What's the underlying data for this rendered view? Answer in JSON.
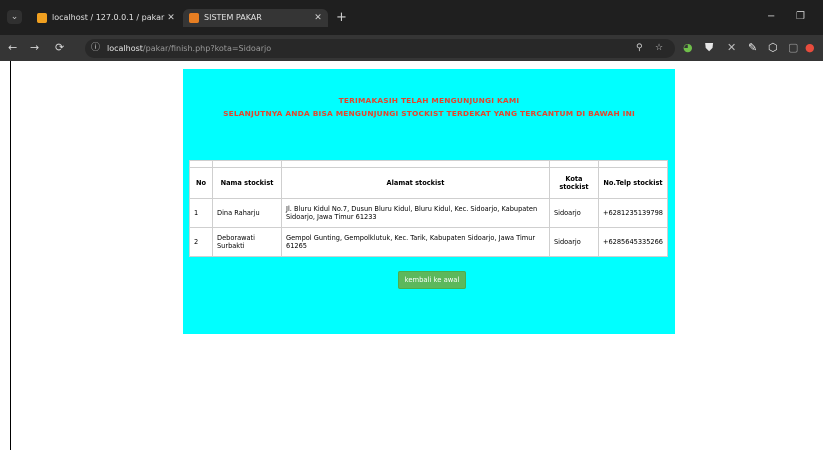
{
  "browser": {
    "tabs": [
      {
        "title": "localhost / 127.0.0.1 / pakar | ph",
        "close": "✕",
        "active": false
      },
      {
        "title": "SISTEM PAKAR",
        "close": "✕",
        "active": true
      }
    ],
    "new_tab": "+",
    "window": {
      "minimize": "−",
      "restore": "❐"
    },
    "nav": {
      "back": "←",
      "forward": "→",
      "reload": "⟳",
      "tab_menu": "⌄"
    },
    "url": {
      "host": "localhost",
      "path": "/pakar/finish.php?kota=Sidoarjo",
      "info_icon": "ⓘ"
    },
    "omnibox_icons": {
      "zoom": "⚲",
      "bookmark": "☆"
    },
    "extensions": [
      "◕",
      "⛊",
      "✕",
      "✎",
      "⬡",
      "▢",
      "●"
    ]
  },
  "page": {
    "heading_line1": "TERIMAKASIH TELAH MENGUNJUNGI KAMI",
    "heading_line2": "SELANJUTNYA ANDA BISA MENGUNJUNGI STOCKIST TERDEKAT YANG TERCANTUM DI BAWAH INI",
    "table": {
      "headers": [
        "No",
        "Nama stockist",
        "Alamat stockist",
        "Kota stockist",
        "No.Telp stockist"
      ],
      "rows": [
        [
          "1",
          "Dina Raharju",
          "Jl. Bluru Kidul No.7, Dusun Bluru Kidul, Bluru Kidul, Kec. Sidoarjo, Kabupaten Sidoarjo, Jawa Timur 61233",
          "Sidoarjo",
          "+6281235139798"
        ],
        [
          "2",
          "Deborawati Surbakti",
          "Gempol Gunting, Gempolklutuk, Kec. Tarik, Kabupaten Sidoarjo, Jawa Timur 61265",
          "Sidoarjo",
          "+6285645335266"
        ]
      ]
    },
    "button_label": "kembali ke awal"
  },
  "colors": {
    "panel_bg": "#00ffff",
    "heading": "#e3452d",
    "button_bg": "#5cb85c",
    "chrome_bg": "#1f1f1f"
  }
}
